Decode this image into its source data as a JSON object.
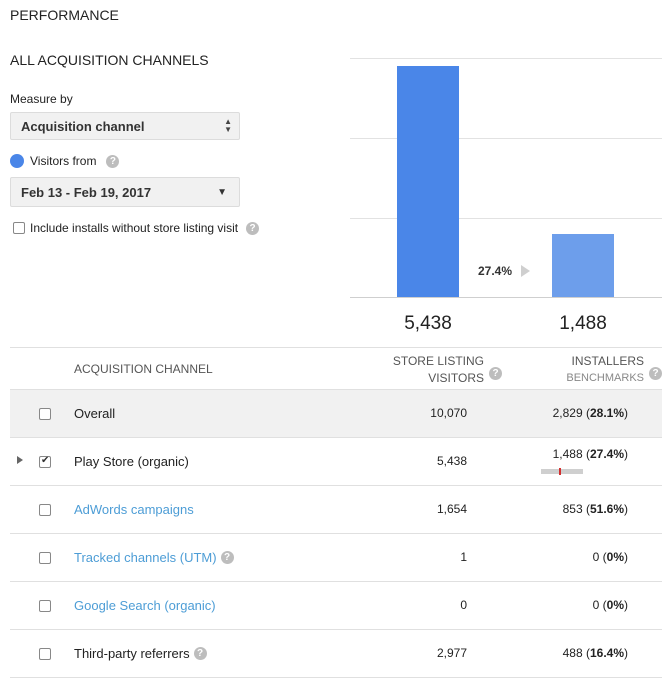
{
  "page": {
    "title": "PERFORMANCE",
    "section_title": "ALL ACQUISITION CHANNELS"
  },
  "controls": {
    "measure_label": "Measure by",
    "measure_value": "Acquisition channel",
    "visitors_label": "Visitors from",
    "date_range": "Feb 13 - Feb 19, 2017",
    "include_label": "Include installs without store listing visit",
    "include_checked": false
  },
  "colors": {
    "visitors_bar": "#4a86e8",
    "installers_bar": "#6d9eeb",
    "link": "#4d9dd6"
  },
  "chart_data": {
    "type": "bar",
    "categories": [
      "Store listing visitors",
      "Installers"
    ],
    "values": [
      5438,
      1488
    ],
    "value_labels": [
      "5,438",
      "1,488"
    ],
    "conversion_label": "27.4%",
    "ylim": [
      0,
      5600
    ],
    "grid": true
  },
  "table": {
    "headers": {
      "channel": "ACQUISITION CHANNEL",
      "visitors_line1": "STORE LISTING",
      "visitors_line2": "VISITORS",
      "installers_line1": "INSTALLERS",
      "installers_line2": "BENCHMARKS"
    },
    "rows": [
      {
        "name": "Overall",
        "visitors": "10,070",
        "installers": "2,829",
        "pct": "28.1%",
        "checked": false
      },
      {
        "name": "Play Store (organic)",
        "visitors": "5,438",
        "installers": "1,488",
        "pct": "27.4%",
        "checked": true,
        "benchmark_position": 0.45
      },
      {
        "name": "AdWords campaigns",
        "visitors": "1,654",
        "installers": "853",
        "pct": "51.6%",
        "checked": false
      },
      {
        "name": "Tracked channels (UTM)",
        "visitors": "1",
        "installers": "0",
        "pct": "0%",
        "checked": false
      },
      {
        "name": "Google Search (organic)",
        "visitors": "0",
        "installers": "0",
        "pct": "0%",
        "checked": false
      },
      {
        "name": "Third-party referrers",
        "visitors": "2,977",
        "installers": "488",
        "pct": "16.4%",
        "checked": false
      }
    ]
  },
  "icons": {
    "help": "?",
    "select_arrows": "⬍",
    "dropdown": "▼"
  }
}
